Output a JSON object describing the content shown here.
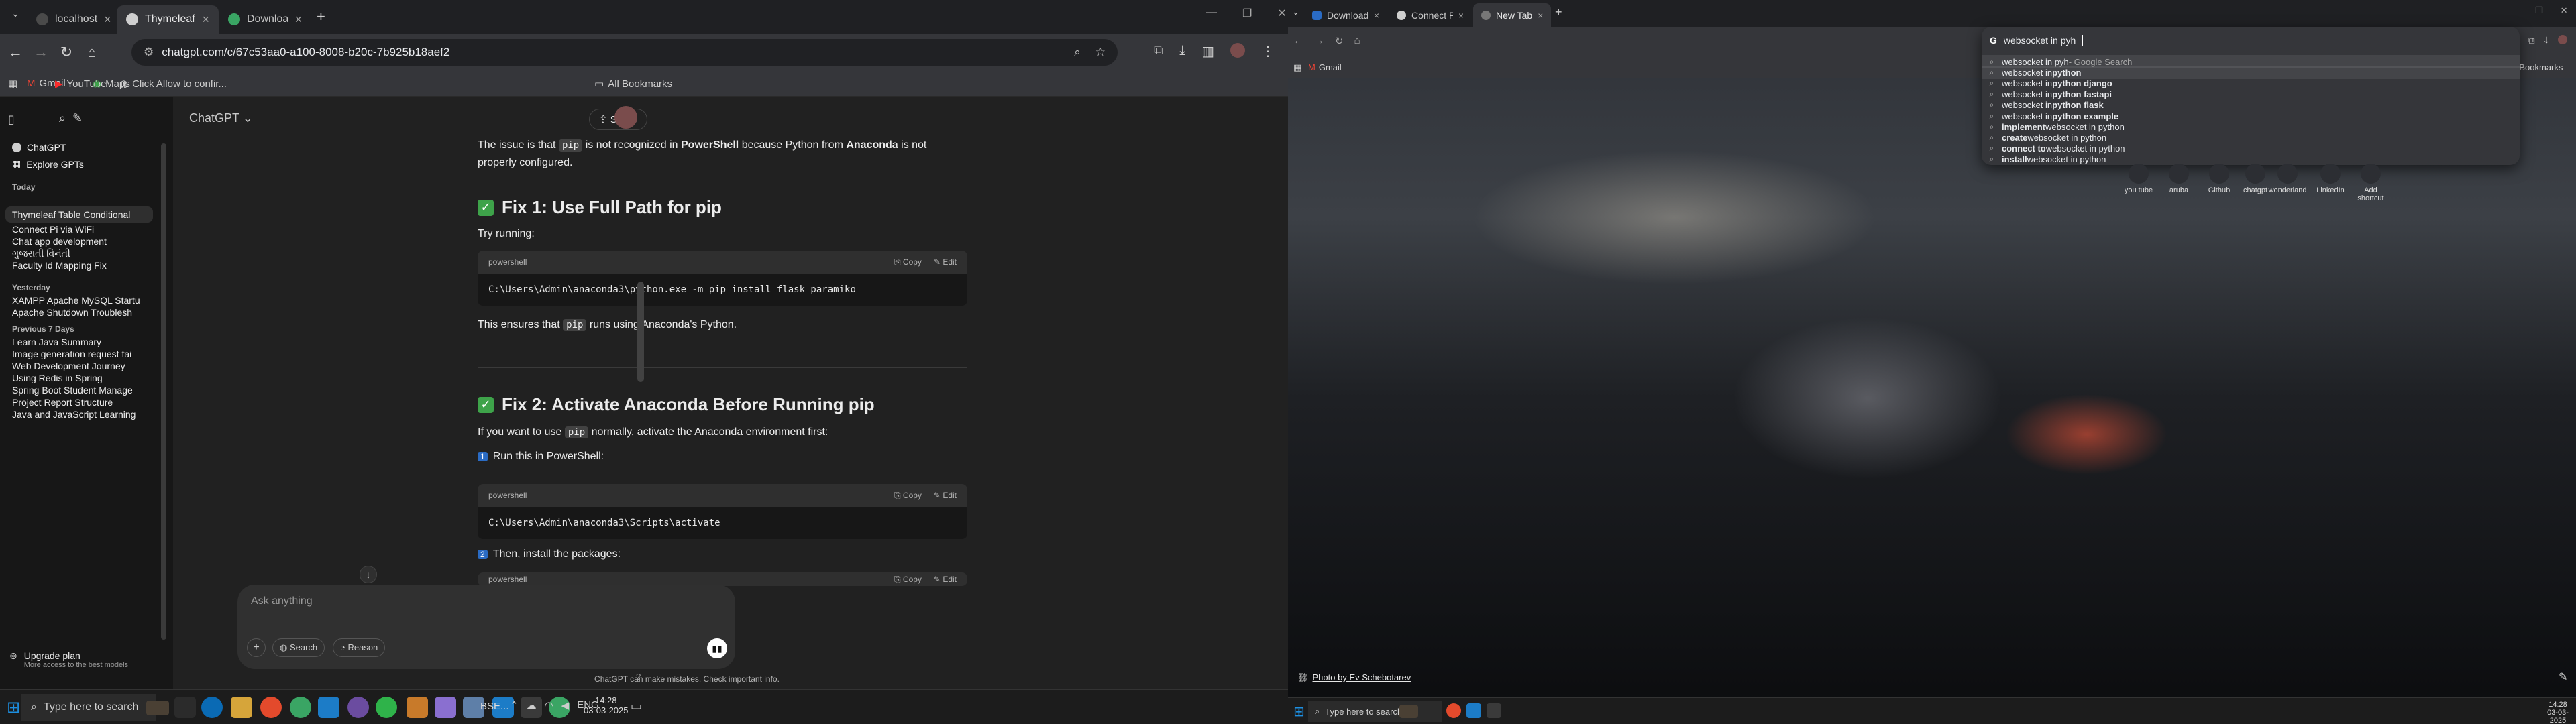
{
  "left": {
    "tabs": [
      {
        "label": "localhost",
        "active": false
      },
      {
        "label": "Thymeleaf Table Conditional Lo",
        "active": true
      },
      {
        "label": "Download Anaconda Distributio",
        "active": false
      }
    ],
    "url": "chatgpt.com/c/67c53aa0-a100-8008-b20c-7b925b18aef2",
    "bookmarks": [
      "Gmail",
      "YouTube",
      "Maps",
      "Click Allow to confir...",
      "All Bookmarks"
    ],
    "app_title": "ChatGPT",
    "share_label": "Share",
    "sidebar": {
      "top_items": [
        "ChatGPT",
        "Explore GPTs"
      ],
      "groups": [
        {
          "heading": "Today",
          "items": [
            "Thymeleaf Table Conditional",
            "Connect Pi via WiFi",
            "Chat app development",
            "ગુજરાતી વિનંતી",
            "Faculty Id Mapping Fix"
          ]
        },
        {
          "heading": "Yesterday",
          "items": [
            "XAMPP Apache MySQL Startu",
            "Apache Shutdown Troublesh"
          ]
        },
        {
          "heading": "Previous 7 Days",
          "items": [
            "Learn Java Summary",
            "Image generation request fai",
            "Web Development Journey",
            "Using Redis in Spring",
            "Spring Boot Student Manage",
            "Project Report Structure",
            "Java and JavaScript Learning"
          ]
        }
      ],
      "upgrade_title": "Upgrade plan",
      "upgrade_sub": "More access to the best models"
    },
    "chat": {
      "intro_parts": [
        "The issue is that ",
        "pip",
        " is not recognized in ",
        "PowerShell",
        " because Python from ",
        "Anaconda",
        " is not properly configured."
      ],
      "fix1_title": "Fix 1: Use Full Path for pip",
      "try_running": "Try running:",
      "code_lang": "powershell",
      "copy_label": "Copy",
      "edit_label": "Edit",
      "code1": "C:\\Users\\Admin\\anaconda3\\python.exe -m pip install flask paramiko",
      "ensures_parts": [
        "This ensures that ",
        "pip",
        " runs using Anaconda's Python."
      ],
      "fix2_title": "Fix 2: Activate Anaconda Before Running pip",
      "fix2_text_parts": [
        "If you want to use ",
        "pip",
        " normally, activate the Anaconda environment first:"
      ],
      "step1": "Run this in PowerShell:",
      "code2": "C:\\Users\\Admin\\anaconda3\\Scripts\\activate",
      "step2": "Then, install the packages:"
    },
    "composer": {
      "placeholder": "Ask anything",
      "search": "Search",
      "reason": "Reason"
    },
    "footer_note": "ChatGPT can make mistakes. Check important info.",
    "taskbar": {
      "search_placeholder": "Type here to search",
      "lang": "ENG",
      "time": "14:28",
      "date": "03-03-2025",
      "tray_text": "BSE..."
    }
  },
  "right": {
    "tabs": [
      {
        "label": "Download the combined Real-",
        "active": false
      },
      {
        "label": "Connect Pi via WiFi",
        "active": false
      },
      {
        "label": "New Tab",
        "active": true
      }
    ],
    "bookmarks": [
      "Gmail",
      "All Bookmarks"
    ],
    "omnibox_text": "websocket in pyh",
    "suggestions": [
      {
        "pre": "websocket in pyh",
        "bold": "",
        "post": " - Google Search"
      },
      {
        "pre": "websocket in ",
        "bold": "python",
        "post": ""
      },
      {
        "pre": "websocket in ",
        "bold": "python django",
        "post": ""
      },
      {
        "pre": "websocket in ",
        "bold": "python fastapi",
        "post": ""
      },
      {
        "pre": "websocket in ",
        "bold": "python flask",
        "post": ""
      },
      {
        "pre": "websocket in ",
        "bold": "python example",
        "post": ""
      },
      {
        "pre": "",
        "bold": "implement",
        "post": " websocket in python"
      },
      {
        "pre": "",
        "bold": "create",
        "post": " websocket in python"
      },
      {
        "pre": "",
        "bold": "connect to",
        "post": " websocket in python"
      },
      {
        "pre": "",
        "bold": "install",
        "post": " websocket in python"
      }
    ],
    "shortcuts": [
      "you tube",
      "aruba",
      "Github",
      "chatgpt",
      "wonderland",
      "LinkedIn",
      "Add shortcut"
    ],
    "photo_credit": "Photo by Ev Schebotarev",
    "taskbar": {
      "search_placeholder": "Type here to search",
      "time": "14:28",
      "date": "03-03-2025"
    }
  }
}
